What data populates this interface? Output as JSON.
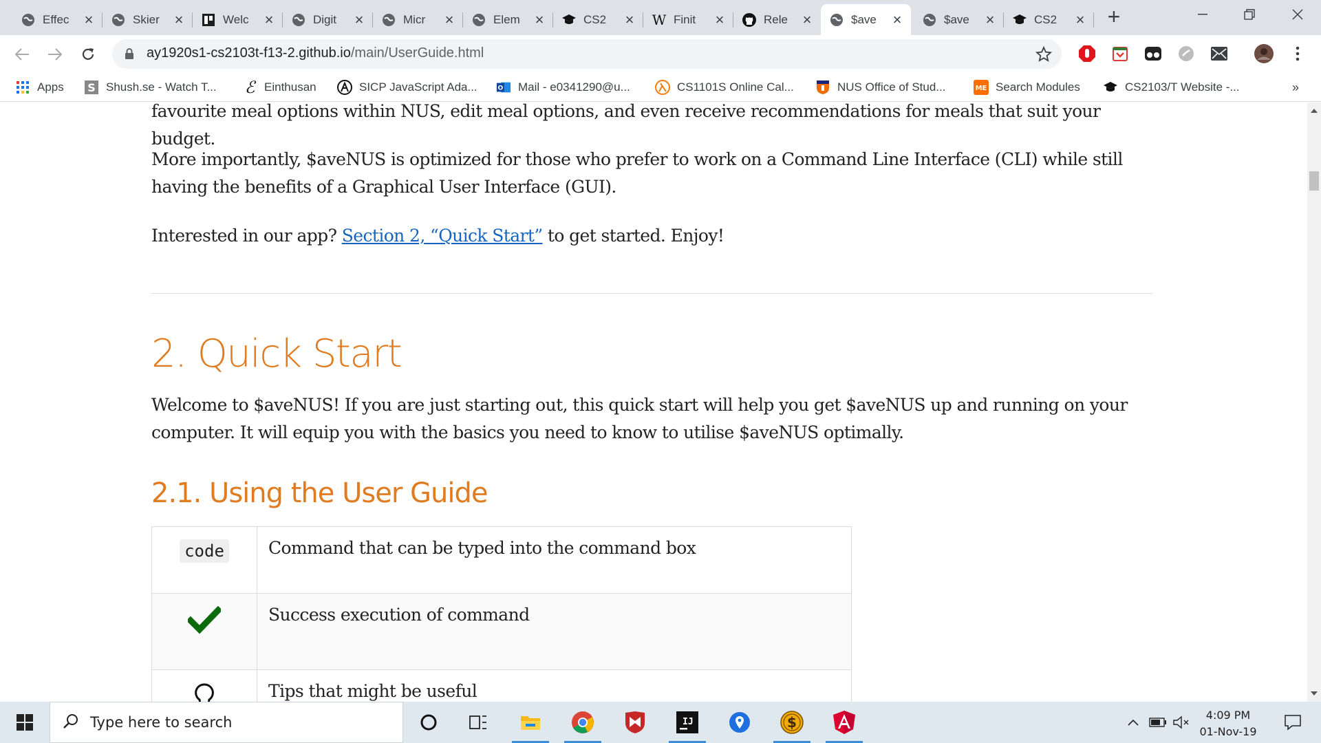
{
  "browser": {
    "tabs": [
      {
        "title": "Effec",
        "icon": "globe-icon"
      },
      {
        "title": "Skier",
        "icon": "globe-icon"
      },
      {
        "title": "Welc",
        "icon": "trello-icon"
      },
      {
        "title": "Digit",
        "icon": "globe-icon"
      },
      {
        "title": "Micr",
        "icon": "globe-icon"
      },
      {
        "title": "Elem",
        "icon": "globe-icon"
      },
      {
        "title": "CS2",
        "icon": "graduation-cap-icon"
      },
      {
        "title": "Finit",
        "icon": "wikipedia-icon"
      },
      {
        "title": "Rele",
        "icon": "github-icon"
      },
      {
        "title": "$ave",
        "icon": "globe-icon",
        "active": true
      },
      {
        "title": "$ave",
        "icon": "globe-icon"
      },
      {
        "title": "CS2",
        "icon": "graduation-cap-icon"
      }
    ],
    "url_host": "ay1920s1-cs2103t-f13-2.github.io",
    "url_path": "/main/UserGuide.html",
    "bookmarks": [
      {
        "label": "Apps",
        "icon": "apps-grid-icon"
      },
      {
        "label": "Shush.se - Watch T...",
        "icon": "shush-icon"
      },
      {
        "label": "Einthusan",
        "icon": "einthusan-icon"
      },
      {
        "label": "SICP JavaScript Ada...",
        "icon": "sicp-icon"
      },
      {
        "label": "Mail - e0341290@u...",
        "icon": "outlook-icon"
      },
      {
        "label": "CS1101S Online Cal...",
        "icon": "lambda-icon"
      },
      {
        "label": "NUS Office of Stud...",
        "icon": "nus-crest-icon"
      },
      {
        "label": "Search Modules",
        "icon": "me-icon"
      },
      {
        "label": "CS2103/T Website -...",
        "icon": "graduation-cap-icon"
      }
    ],
    "bookmarks_overflow": "»"
  },
  "page": {
    "intro_tail": "favourite meal options within NUS, edit meal options, and even receive recommendations for meals that suit your budget.",
    "cli_paragraph": "More importantly, $aveNUS is optimized for those who prefer to work on a Command Line Interface (CLI) while still having the benefits of a Graphical User Interface (GUI).",
    "interest_prefix": "Interested in our app? ",
    "interest_link": "Section 2, “Quick Start”",
    "interest_suffix": " to get started. Enjoy!",
    "quick_start_heading": "2. Quick Start",
    "quick_start_paragraph": "Welcome to $aveNUS! If you are just starting out, this quick start will help you get $aveNUS up and running on your computer. It will equip you with the basics you need to know to utilise $aveNUS optimally.",
    "user_guide_heading": "2.1. Using the User Guide",
    "legend": [
      {
        "symbol": "code",
        "description": "Command that can be typed into the command box"
      },
      {
        "symbol": "checkmark-icon",
        "description": "Success execution of command"
      },
      {
        "symbol": "lightbulb-icon",
        "description": "Tips that might be useful"
      }
    ]
  },
  "taskbar": {
    "search_placeholder": "Type here to search",
    "time": "4:09 PM",
    "date": "01-Nov-19",
    "pinned": [
      "cortana-icon",
      "task-view-icon",
      "file-explorer-icon",
      "chrome-icon",
      "mcafee-icon",
      "intellij-icon",
      "maps-icon",
      "savenus-app-icon",
      "angular-icon"
    ]
  },
  "colors": {
    "heading_orange": "#e07b1f",
    "link_blue": "#1565c0",
    "tab_strip": "#dee1e6",
    "taskbar": "#dfe7ef"
  }
}
